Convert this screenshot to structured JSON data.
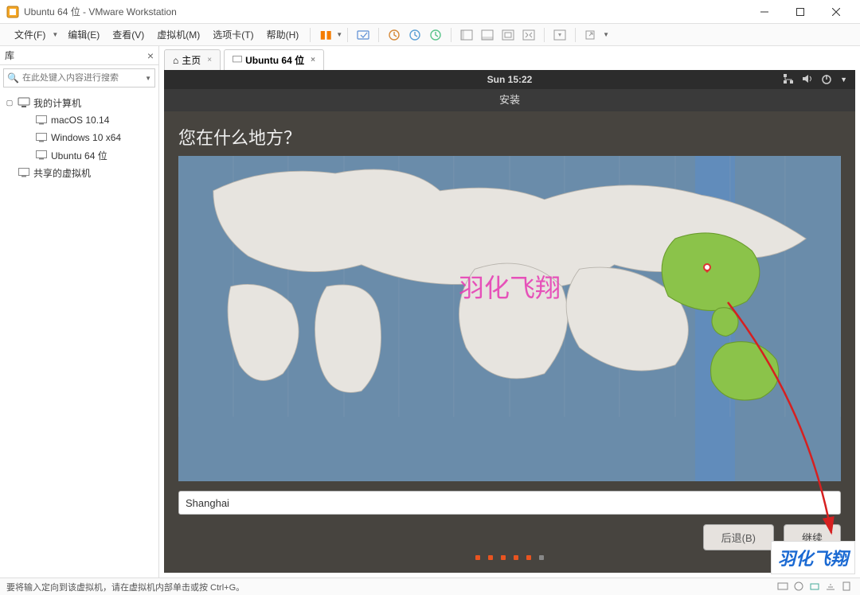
{
  "titlebar": {
    "text": "Ubuntu 64 位 - VMware Workstation"
  },
  "menu": {
    "file": "文件(F)",
    "edit": "编辑(E)",
    "view": "查看(V)",
    "vm": "虚拟机(M)",
    "tabs": "选项卡(T)",
    "help": "帮助(H)"
  },
  "sidebar": {
    "title": "库",
    "search_placeholder": "在此处键入内容进行搜索",
    "root": "我的计算机",
    "items": [
      "macOS 10.14",
      "Windows 10 x64",
      "Ubuntu 64 位"
    ],
    "shared": "共享的虚拟机"
  },
  "tabs": {
    "home": "主页",
    "ubuntu": "Ubuntu 64 位"
  },
  "ubuntu_top": {
    "time": "Sun 15:22",
    "install": "安装"
  },
  "install": {
    "question": "您在什么地方？",
    "location": "Shanghai",
    "back": "后退(B)",
    "continue": "继续"
  },
  "watermark": "羽化飞翔",
  "statusbar": {
    "text": "要将输入定向到该虚拟机，请在虚拟机内部单击或按 Ctrl+G。"
  }
}
